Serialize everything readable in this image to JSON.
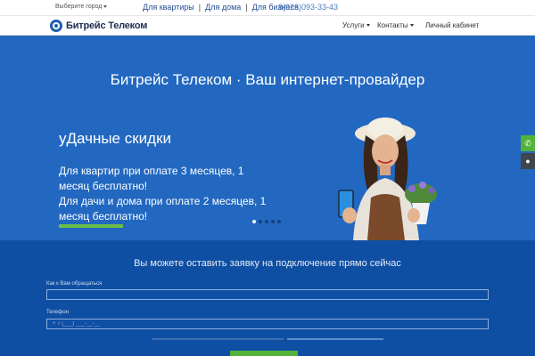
{
  "topbar": {
    "city_label": "Выберите город",
    "links": [
      "Для квартиры",
      "Для дома",
      "Для бизнеса"
    ],
    "phone": "8(926)093-33-43"
  },
  "nav": {
    "logo_text": "Битрейс Телеком",
    "services": "Услуги",
    "contacts": "Контакты",
    "cabinet": "Личный кабинет"
  },
  "hero": {
    "title": "Битрейс Телеком · Ваш интернет-провайдер",
    "slide_title": "уДачные скидки",
    "slide_text_1": "Для квартир при оплате 3 месяцев, 1 месяц бесплатно!",
    "slide_text_2": "Для дачи и дома при оплате 2 месяцев, 1 месяц бесплатно!",
    "slide_count": 5,
    "active_slide": 1
  },
  "form": {
    "title": "Вы можете оставить заявку на подключение прямо сейчас",
    "name_label": "Как к Вам обращаться",
    "phone_label": "Телефон",
    "phone_placeholder": "+ 7 (___) ___-__-__"
  },
  "side": {
    "phone_icon": "phone-icon",
    "location_icon": "location-pin-icon"
  },
  "colors": {
    "hero_bg": "#2268c0",
    "form_bg": "#0f4fa3",
    "accent_green": "#52b33b",
    "brand_blue": "#1f5fae"
  }
}
